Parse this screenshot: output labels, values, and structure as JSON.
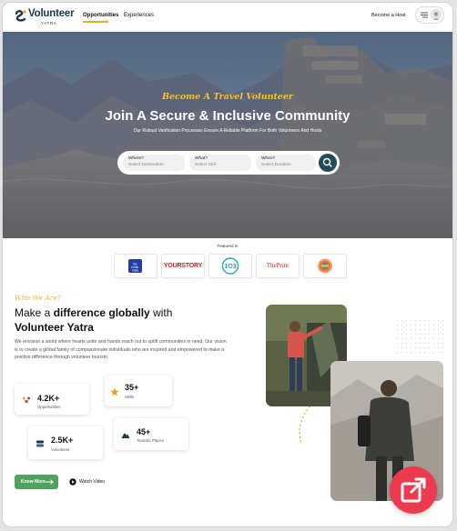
{
  "header": {
    "logo_name": "Volunteer",
    "logo_sub": "YATRA",
    "nav": [
      {
        "label": "Opportunities",
        "active": true
      },
      {
        "label": "Experiences",
        "active": false
      }
    ],
    "host_label": "Become a Host"
  },
  "hero": {
    "tagline": "Become A Travel Volunteer",
    "title": "Join A Secure & Inclusive Community",
    "subtitle": "Our Robust Verification Processes Ensure A Reliable Platform For Both Volunteers And Hosts",
    "search": {
      "fields": [
        {
          "label": "Where?",
          "placeholder": "Select Destination"
        },
        {
          "label": "What?",
          "placeholder": "Select Skill"
        },
        {
          "label": "When?",
          "placeholder": "Select Duration"
        }
      ],
      "button_icon": "search-icon"
    }
  },
  "featured": {
    "title": "Featured In",
    "logos": [
      {
        "name": "The Better India",
        "text": "the better india",
        "color": "#1f3fa8"
      },
      {
        "name": "YourStory",
        "text": "YOURSTORY",
        "color": "#d61f26"
      },
      {
        "name": "103",
        "text": "1O3",
        "color": "#2aa6bd"
      },
      {
        "name": "ThePrint",
        "text": "ThePrint",
        "color": "#c62828"
      },
      {
        "name": "Colorful badge",
        "text": "",
        "color": "#e76f51"
      }
    ]
  },
  "about": {
    "eyebrow": "Who We Are?",
    "title_prefix": "Make a",
    "title_highlight": "difference globally",
    "title_suffix": "with",
    "title_line2": "Volunteer Yatra",
    "body": "We envision a world where hearts unite and hands reach out to uplift communities in need. Our vision is to create a global family of compassionate individuals who are inspired and empowered to make a positive difference through volunteer tourism.",
    "stats": [
      {
        "value": "4.2K+",
        "label": "Opportunities",
        "icon": "people-icon"
      },
      {
        "value": "35+",
        "label": "Skills",
        "icon": "star-icon"
      },
      {
        "value": "2.5K+",
        "label": "Volunteers",
        "icon": "volunteer-icon"
      },
      {
        "value": "45+",
        "label": "Touristic Places",
        "icon": "mountain-icon"
      }
    ],
    "know_more": "Know More",
    "watch_video": "Watch Video"
  },
  "colors": {
    "brand_dark": "#1d3a46",
    "accent_yellow": "#e9b43a",
    "button_green": "#4fa35f",
    "share_red": "#ec3a4e"
  }
}
